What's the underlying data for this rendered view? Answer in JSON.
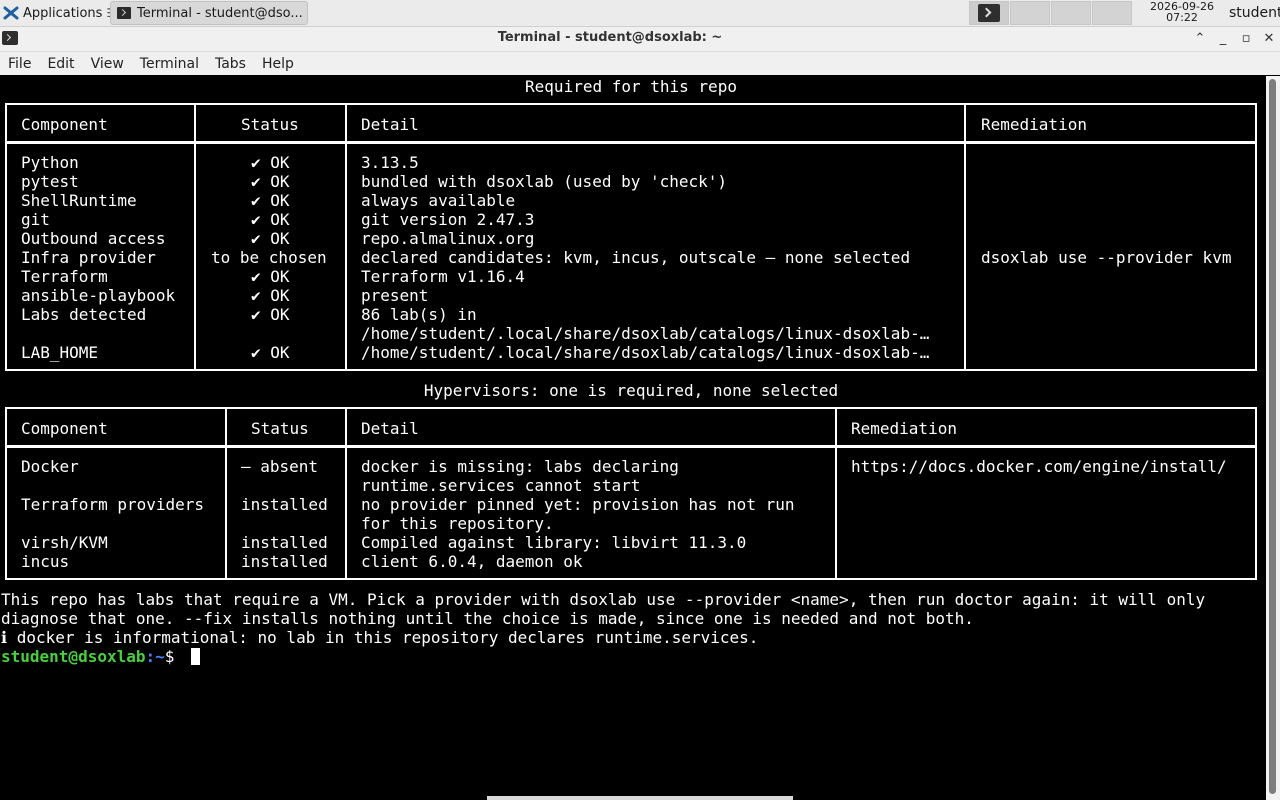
{
  "panel": {
    "apps_label": "Applications",
    "task_label": "Terminal - student@dso...",
    "clock_date": "2026-09-26",
    "clock_time": "07:22",
    "user": "student"
  },
  "window": {
    "title": "Terminal - student@dsoxlab: ~",
    "buttons": {
      "shade": "⌃",
      "minimize": "_",
      "maximize": "▫",
      "close": "✕"
    }
  },
  "menubar": {
    "items": [
      "File",
      "Edit",
      "View",
      "Terminal",
      "Tabs",
      "Help"
    ]
  },
  "required": {
    "title": "Required for this repo",
    "headers": [
      "Component",
      "Status",
      "Detail",
      "Remediation"
    ],
    "rows": [
      {
        "component": "Python",
        "status": "✔ OK",
        "detail": "3.13.5"
      },
      {
        "component": "pytest",
        "status": "✔ OK",
        "detail": "bundled with dsoxlab (used by 'check')"
      },
      {
        "component": "ShellRuntime",
        "status": "✔ OK",
        "detail": "always available"
      },
      {
        "component": "git",
        "status": "✔ OK",
        "detail": "git version 2.47.3"
      },
      {
        "component": "Outbound access",
        "status": "✔ OK",
        "detail": "repo.almalinux.org"
      },
      {
        "component": "Infra provider",
        "status": "to be chosen",
        "detail": "declared candidates: kvm, incus, outscale — none selected",
        "remediation": "dsoxlab use --provider kvm"
      },
      {
        "component": "Terraform",
        "status": "✔ OK",
        "detail": "Terraform v1.16.4"
      },
      {
        "component": "ansible-playbook",
        "status": "✔ OK",
        "detail": "present"
      },
      {
        "component": "Labs detected",
        "status": "✔ OK",
        "detail": "86 lab(s) in",
        "detail2": "/home/student/.local/share/dsoxlab/catalogs/linux-dsoxlab-…"
      },
      {
        "component": "LAB_HOME",
        "status": "✔ OK",
        "detail": "/home/student/.local/share/dsoxlab/catalogs/linux-dsoxlab-…"
      }
    ]
  },
  "hypervisors": {
    "title": "Hypervisors: one is required, none selected",
    "headers": [
      "Component",
      "Status",
      "Detail",
      "Remediation"
    ],
    "rows": [
      {
        "component": "Docker",
        "status": "— absent",
        "detail": "docker is missing: labs declaring",
        "detail2": "runtime.services cannot start",
        "remediation": "https://docs.docker.com/engine/install/"
      },
      {
        "component": "Terraform providers",
        "status": "installed",
        "detail": "no provider pinned yet: provision has not run",
        "detail2": "for this repository."
      },
      {
        "component": "virsh/KVM",
        "status": "installed",
        "detail": "Compiled against library: libvirt 11.3.0"
      },
      {
        "component": "incus",
        "status": "installed",
        "detail": "client 6.0.4, daemon ok"
      }
    ]
  },
  "messages": {
    "line1": "This repo has labs that require a VM. Pick a provider with dsoxlab use --provider <name>, then run doctor again: it will only",
    "line2": "diagnose that one. --fix installs nothing until the choice is made, since one is needed and not both.",
    "line3": "ℹ docker is informational: no lab in this repository declares runtime.services."
  },
  "prompt": {
    "user_host": "student@dsoxlab",
    "path": ":~",
    "symbol": "$ "
  }
}
